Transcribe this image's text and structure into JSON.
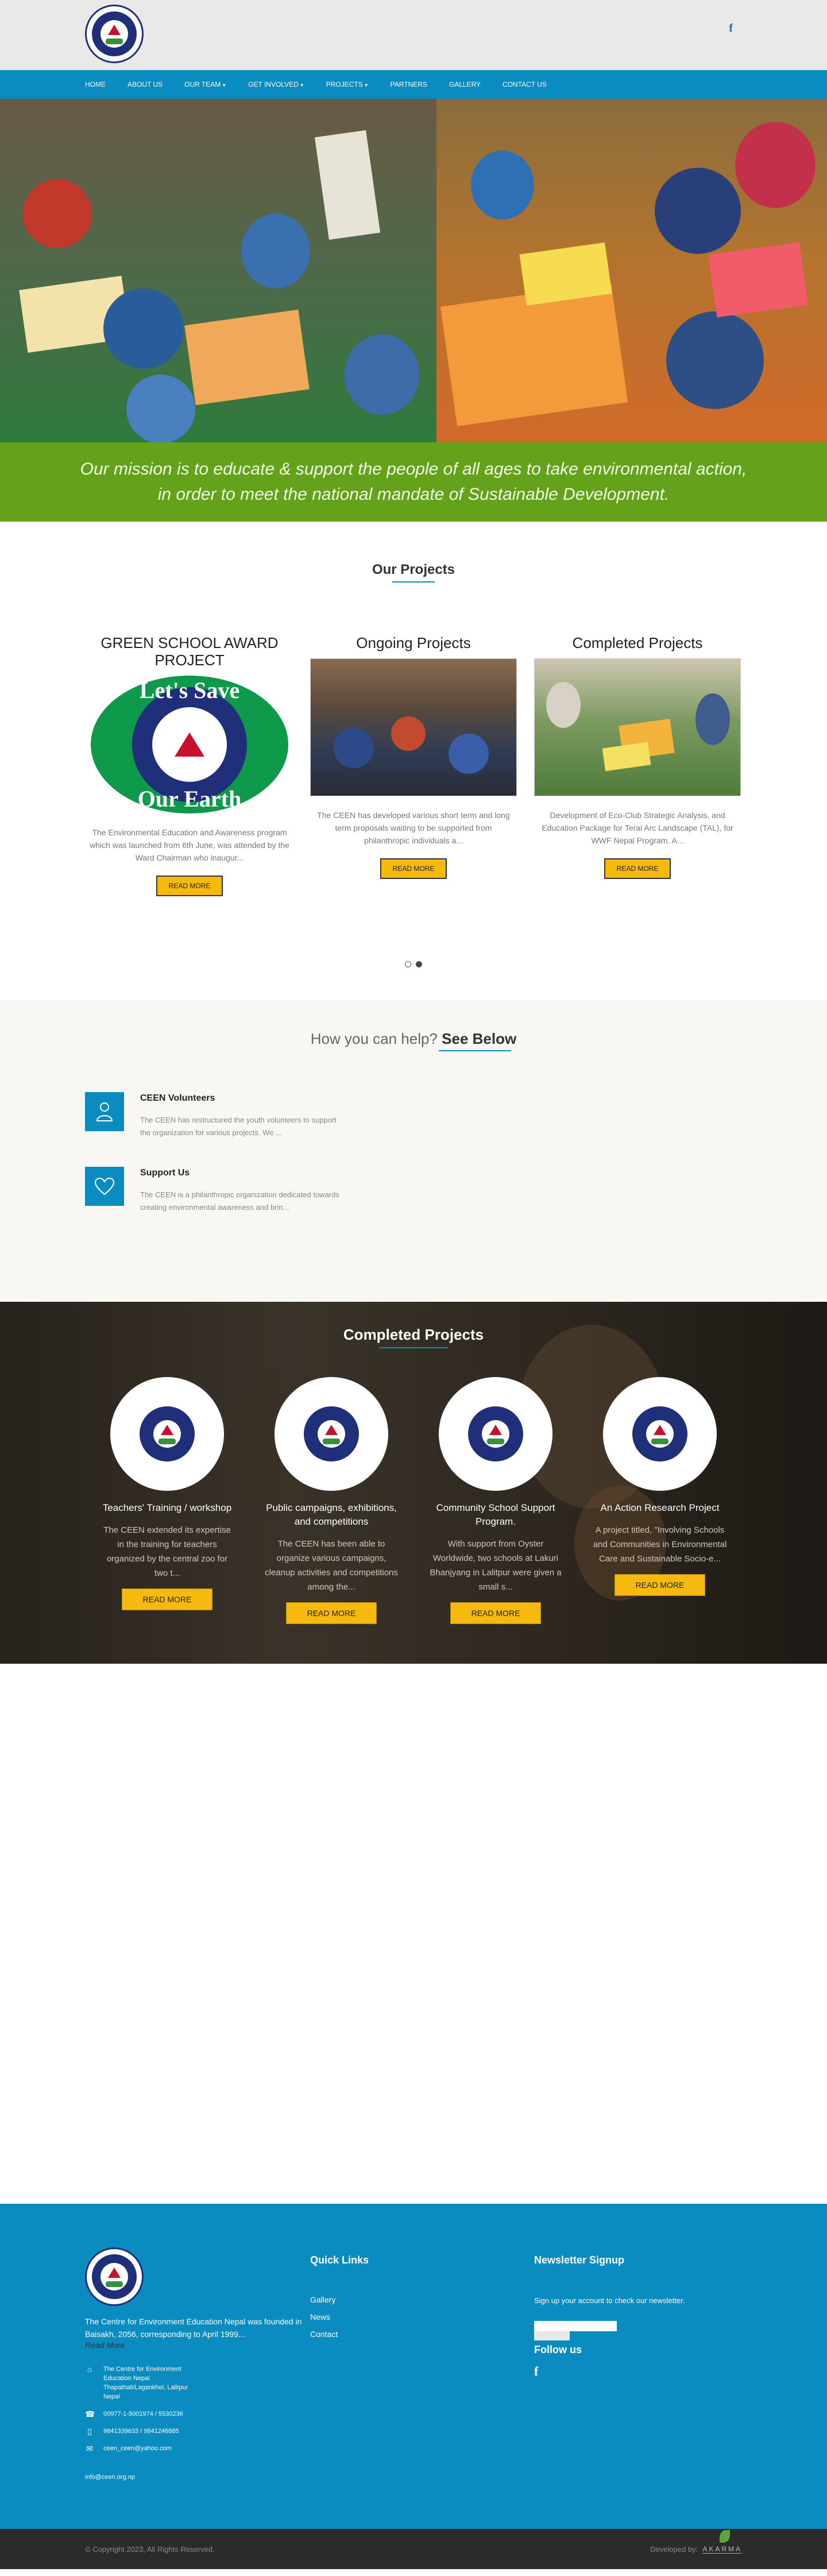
{
  "brand": {
    "name": "Centre for Environment Education Nepal"
  },
  "nav": {
    "home": "HOME",
    "about": "ABOUT US",
    "team": "OUR TEAM",
    "involved": "GET INVOLVED",
    "projects": "PROJECTS",
    "partners": "PARTNERS",
    "gallery": "GALLERY",
    "contact": "CONTACT US"
  },
  "social": {
    "facebook_glyph": "f"
  },
  "mission": {
    "line1": "Our mission is to educate & support the people of all ages to take environmental action,",
    "line2": "in order to meet the national mandate of Sustainable Development."
  },
  "projects": {
    "title": "Our Projects",
    "items": [
      {
        "title": "GREEN SCHOOL AWARD PROJECT",
        "desc": "The Environmental Education and Awareness program which was launched from 6th June, was attended by the Ward Chairman who inaugur...",
        "button": "READ MORE",
        "badge_top": "Let's Save",
        "badge_bottom": "Our Earth"
      },
      {
        "title": "Ongoing Projects",
        "desc": "The CEEN has developed various short term and long term proposals waiting to be supported from philanthropic individuals a...",
        "button": "READ MORE"
      },
      {
        "title": "Completed Projects",
        "desc": "Development of Eco-Club Strategic Analysis, and Education Package for Terai Arc Landscape (TAL), for WWF Nepal Program. A...",
        "button": "READ MORE"
      }
    ]
  },
  "help": {
    "title_prefix": "How you can help?",
    "title_strong": "See Below",
    "items": [
      {
        "title": "CEEN Volunteers",
        "desc": "The CEEN has restructured the youth volunteers to support the organization for various projects. We ..."
      },
      {
        "title": "Support Us",
        "desc": "The CEEN is a philanthropic organization dedicated towards creating environmental awareness and brin..."
      }
    ]
  },
  "completed": {
    "title": "Completed Projects",
    "items": [
      {
        "title": "Teachers' Training / workshop",
        "desc": "The CEEN extended its expertise in the training for teachers organized by the central zoo for two t...",
        "button": "READ MORE"
      },
      {
        "title": "Public campaigns, exhibitions, and competitions",
        "desc": "The CEEN has been able to organize various campaigns, cleanup activities and competitions among the...",
        "button": "READ MORE"
      },
      {
        "title": "Community School Support Program.",
        "desc": "With support from Oyster Worldwide, two schools at Lakuri Bhanjyang in Lalitpur were given a small s...",
        "button": "READ MORE"
      },
      {
        "title": "An Action Research Project",
        "desc": "A project titled, \"Involving Schools and Communities in Environmental Care and Sustainable Socio-e...",
        "button": "READ MORE"
      }
    ]
  },
  "footer": {
    "about": "The Centre for Environment Education Nepal was founded in Baisakh, 2056, corresponding to April 1999...",
    "read_more": "Read More",
    "address": "The Centre for Environment Education Nepal Thapathali/Lagankhel, Lalitpur Nepal",
    "phone": "00977-1-5001974 / 5530236",
    "mobile": "9841339633 / 9841246885",
    "email_alt": "ceen_ceen@yahoo.com",
    "email": "info@ceen.org.np",
    "quick_links_title": "Quick Links",
    "links": [
      "Gallery",
      "News",
      "Contact"
    ],
    "newsletter_title": "Newsletter Signup",
    "newsletter_text": "Sign up your account to check our newsletter.",
    "follow_title": "Follow us",
    "fb_glyph": "f"
  },
  "bottom": {
    "copyright": "© Copyright 2023, All Rights Reserved.",
    "developed_by": "Developed by:",
    "developer": "AKARMA"
  },
  "colors": {
    "nav": "#0a8cc0",
    "mission": "#63a21a",
    "button": "#f5b910",
    "footer": "#0a8cc0"
  }
}
